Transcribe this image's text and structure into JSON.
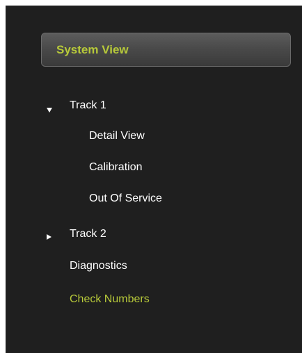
{
  "header": {
    "label": "System View"
  },
  "nav": {
    "track1": {
      "label": "Track 1",
      "expanded": true,
      "children": [
        {
          "label": "Detail View"
        },
        {
          "label": "Calibration"
        },
        {
          "label": "Out Of Service"
        }
      ]
    },
    "track2": {
      "label": "Track 2",
      "expanded": false
    },
    "diagnostics": {
      "label": "Diagnostics"
    },
    "check_numbers": {
      "label": "Check Numbers",
      "active": true
    }
  },
  "colors": {
    "accent": "#b7c93a",
    "background": "#1f1f1f",
    "text": "#ffffff"
  }
}
